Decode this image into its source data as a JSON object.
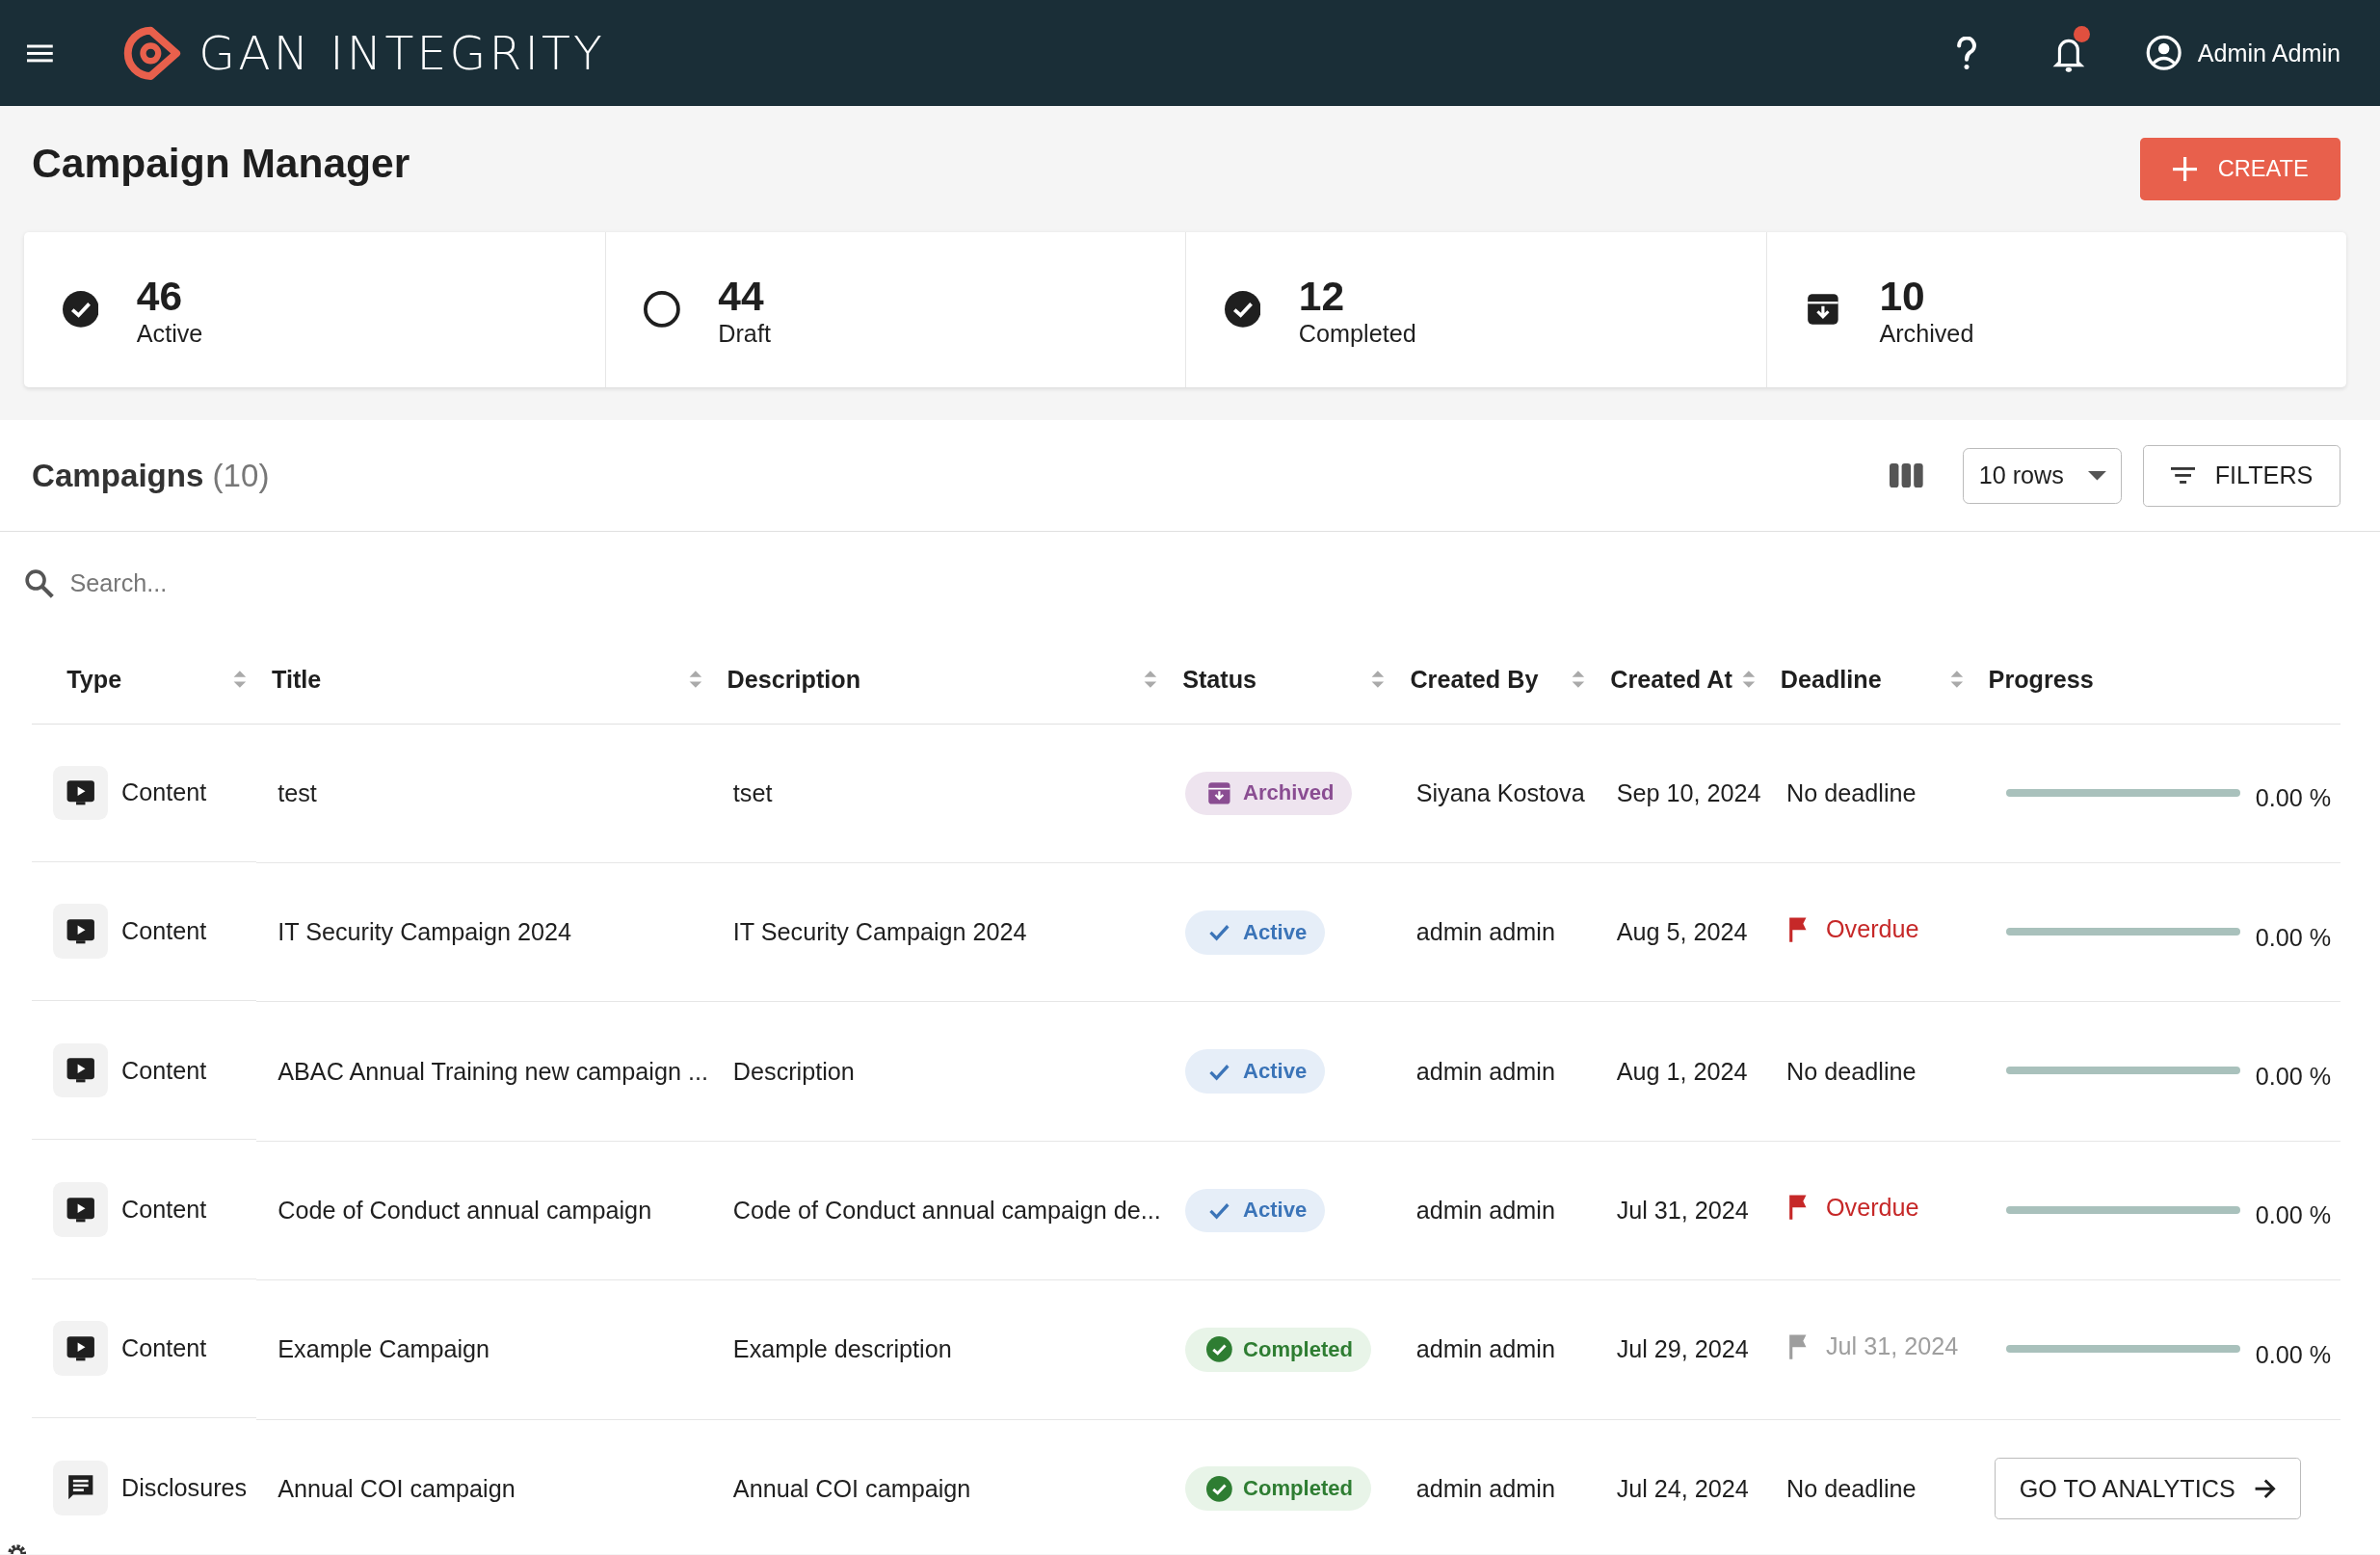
{
  "header": {
    "brand": "GAN INTEGRITY",
    "user": "Admin Admin",
    "notification_badge": true
  },
  "page_title": "Campaign Manager",
  "create_button": "CREATE",
  "stats": [
    {
      "kind": "active",
      "count": "46",
      "label": "Active"
    },
    {
      "kind": "draft",
      "count": "44",
      "label": "Draft"
    },
    {
      "kind": "completed",
      "count": "12",
      "label": "Completed"
    },
    {
      "kind": "archived",
      "count": "10",
      "label": "Archived"
    }
  ],
  "campaigns": {
    "title": "Campaigns",
    "count": "(10)",
    "rows_select": "10 rows",
    "filters_button": "FILTERS",
    "search": {
      "placeholder": "Search..."
    },
    "columns": [
      "Type",
      "Title",
      "Description",
      "Status",
      "Created By",
      "Created At",
      "Deadline",
      "Progress"
    ],
    "rows": [
      {
        "type": {
          "kind": "content",
          "label": "Content"
        },
        "title": "test",
        "description": "tset",
        "status": {
          "kind": "archived",
          "label": "Archived"
        },
        "created_by": "Siyana Kostova",
        "created_at": "Sep 10, 2024",
        "deadline": {
          "kind": "none",
          "text": "No deadline"
        },
        "progress": {
          "kind": "bar",
          "level": 0,
          "reading": "0.00 %"
        }
      },
      {
        "type": {
          "kind": "content",
          "label": "Content"
        },
        "title": "IT Security Campaign 2024",
        "description": "IT Security Campaign 2024",
        "status": {
          "kind": "active",
          "label": "Active"
        },
        "created_by": "admin admin",
        "created_at": "Aug 5, 2024",
        "deadline": {
          "kind": "overdue",
          "text": "Overdue"
        },
        "progress": {
          "kind": "bar",
          "level": 0,
          "reading": "0.00 %"
        }
      },
      {
        "type": {
          "kind": "content",
          "label": "Content"
        },
        "title": "ABAC Annual Training new campaign ...",
        "description": "Description",
        "status": {
          "kind": "active",
          "label": "Active"
        },
        "created_by": "admin admin",
        "created_at": "Aug 1, 2024",
        "deadline": {
          "kind": "none",
          "text": "No deadline"
        },
        "progress": {
          "kind": "bar",
          "level": 0,
          "reading": "0.00 %"
        }
      },
      {
        "type": {
          "kind": "content",
          "label": "Content"
        },
        "title": "Code of Conduct annual campaign",
        "description": "Code of Conduct annual campaign de...",
        "status": {
          "kind": "active",
          "label": "Active"
        },
        "created_by": "admin admin",
        "created_at": "Jul 31, 2024",
        "deadline": {
          "kind": "overdue",
          "text": "Overdue"
        },
        "progress": {
          "kind": "bar",
          "level": 0,
          "reading": "0.00 %"
        }
      },
      {
        "type": {
          "kind": "content",
          "label": "Content"
        },
        "title": "Example Campaign",
        "description": "Example description",
        "status": {
          "kind": "completed",
          "label": "Completed"
        },
        "created_by": "admin admin",
        "created_at": "Jul 29, 2024",
        "deadline": {
          "kind": "date",
          "text": "Jul 31, 2024"
        },
        "progress": {
          "kind": "bar",
          "level": 0,
          "reading": "0.00 %"
        }
      },
      {
        "type": {
          "kind": "disclosures",
          "label": "Disclosures"
        },
        "title": "Annual COI campaign",
        "description": "Annual COI campaign",
        "status": {
          "kind": "completed",
          "label": "Completed"
        },
        "created_by": "admin admin",
        "created_at": "Jul 24, 2024",
        "deadline": {
          "kind": "none",
          "text": "No deadline"
        },
        "progress": {
          "kind": "button",
          "label": "GO TO ANALYTICS"
        }
      }
    ]
  }
}
